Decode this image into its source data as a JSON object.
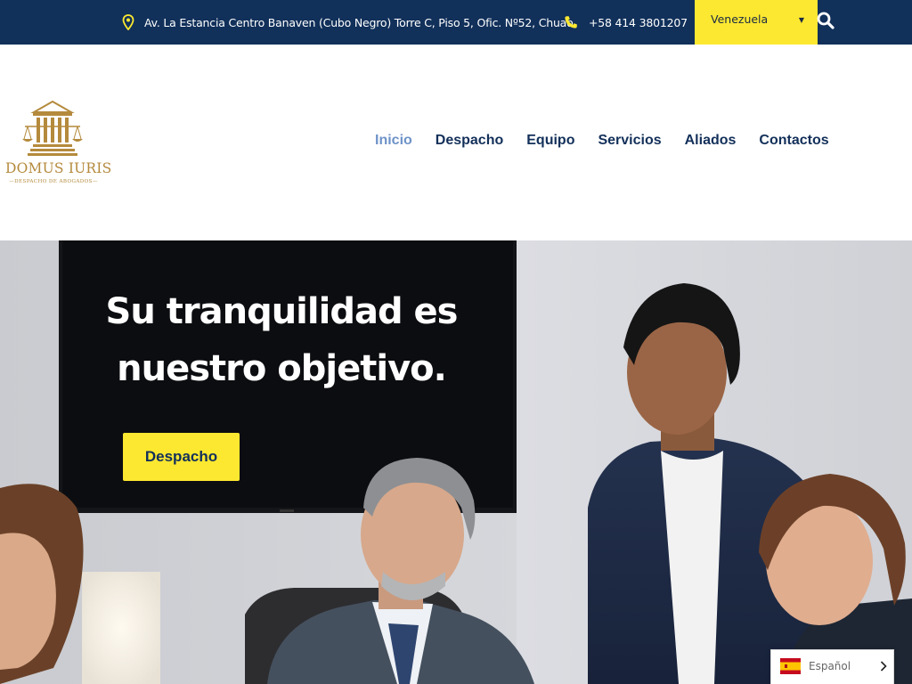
{
  "topbar": {
    "address": "Av. La Estancia Centro Banaven (Cubo Negro) Torre C, Piso 5, Ofic. Nº52, Chuao.",
    "phone": "+58 414 3801207",
    "country_select": {
      "value": "Venezuela"
    },
    "icons": {
      "address": "location-pin-icon",
      "phone": "phone-icon",
      "search": "search-icon"
    }
  },
  "logo": {
    "name": "DOMUS IURIS",
    "subtitle": "—DESPACHO DE ABOGADOS—"
  },
  "nav": {
    "items": [
      {
        "label": "Inicio",
        "active": true
      },
      {
        "label": "Despacho"
      },
      {
        "label": "Equipo"
      },
      {
        "label": "Servicios"
      },
      {
        "label": "Aliados"
      },
      {
        "label": "Contactos"
      }
    ]
  },
  "hero": {
    "title": "Su tranquilidad es nuestro objetivo.",
    "cta_label": "Despacho"
  },
  "language": {
    "label": "Español"
  },
  "colors": {
    "topbar": "#11305a",
    "accent_yellow": "#fce830",
    "nav_text": "#13305a",
    "nav_active": "#6e93c8",
    "logo_gold": "#b48a3c"
  }
}
